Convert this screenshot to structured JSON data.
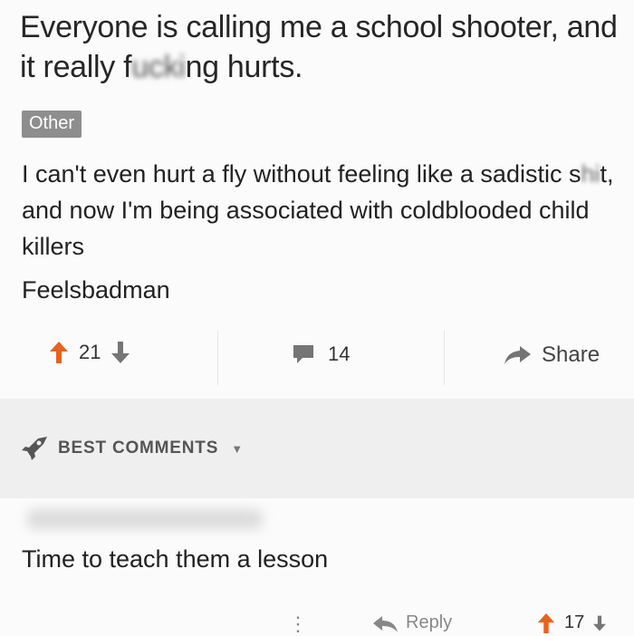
{
  "post": {
    "title_part1": "Everyone is calling me a school shooter, and it really f",
    "title_blurred": "ucki",
    "title_part2": "ng hurts.",
    "category": "Other",
    "body_part1": "I can't even hurt a fly without feeling like a sadistic s",
    "body_blurred": "hi",
    "body_part2": "t, and now I'm being associated with coldblooded child killers",
    "signature": "Feelsbadman"
  },
  "actions": {
    "upvotes": "21",
    "comments": "14",
    "share_label": "Share"
  },
  "comments_section": {
    "header": "BEST COMMENTS",
    "comment_text": "Time to teach them a lesson",
    "reply_label": "Reply",
    "comment_votes": "17"
  },
  "colors": {
    "upvote": "#e8621e",
    "icon_gray": "#757575"
  }
}
